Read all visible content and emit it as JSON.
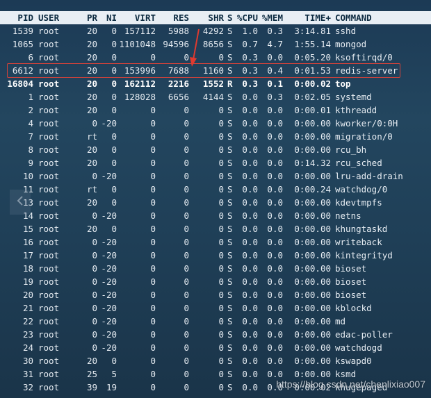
{
  "header": {
    "pid": "PID",
    "user": "USER",
    "pr": "PR",
    "ni": "NI",
    "virt": "VIRT",
    "res": "RES",
    "shr": "SHR",
    "s": "S",
    "cpu": "%CPU",
    "mem": "%MEM",
    "time": "TIME+",
    "cmd": "COMMAND"
  },
  "rows": [
    {
      "pid": "1539",
      "user": "root",
      "pr": "20",
      "ni": "0",
      "virt": "157112",
      "res": "5988",
      "shr": "4292",
      "s": "S",
      "cpu": "1.0",
      "mem": "0.3",
      "time": "3:14.81",
      "cmd": "sshd"
    },
    {
      "pid": "1065",
      "user": "root",
      "pr": "20",
      "ni": "0",
      "virt": "1101048",
      "res": "94596",
      "shr": "8656",
      "s": "S",
      "cpu": "0.7",
      "mem": "4.7",
      "time": "1:55.14",
      "cmd": "mongod"
    },
    {
      "pid": "6",
      "user": "root",
      "pr": "20",
      "ni": "0",
      "virt": "0",
      "res": "0",
      "shr": "0",
      "s": "S",
      "cpu": "0.3",
      "mem": "0.0",
      "time": "0:05.20",
      "cmd": "ksoftirqd/0"
    },
    {
      "pid": "6612",
      "user": "root",
      "pr": "20",
      "ni": "0",
      "virt": "153996",
      "res": "7688",
      "shr": "1160",
      "s": "S",
      "cpu": "0.3",
      "mem": "0.4",
      "time": "0:01.53",
      "cmd": "redis-server"
    },
    {
      "pid": "16804",
      "user": "root",
      "pr": "20",
      "ni": "0",
      "virt": "162112",
      "res": "2216",
      "shr": "1552",
      "s": "R",
      "cpu": "0.3",
      "mem": "0.1",
      "time": "0:00.02",
      "cmd": "top"
    },
    {
      "pid": "1",
      "user": "root",
      "pr": "20",
      "ni": "0",
      "virt": "128028",
      "res": "6656",
      "shr": "4144",
      "s": "S",
      "cpu": "0.0",
      "mem": "0.3",
      "time": "0:02.05",
      "cmd": "systemd"
    },
    {
      "pid": "2",
      "user": "root",
      "pr": "20",
      "ni": "0",
      "virt": "0",
      "res": "0",
      "shr": "0",
      "s": "S",
      "cpu": "0.0",
      "mem": "0.0",
      "time": "0:00.01",
      "cmd": "kthreadd"
    },
    {
      "pid": "4",
      "user": "root",
      "pr": "0",
      "ni": "-20",
      "virt": "0",
      "res": "0",
      "shr": "0",
      "s": "S",
      "cpu": "0.0",
      "mem": "0.0",
      "time": "0:00.00",
      "cmd": "kworker/0:0H"
    },
    {
      "pid": "7",
      "user": "root",
      "pr": "rt",
      "ni": "0",
      "virt": "0",
      "res": "0",
      "shr": "0",
      "s": "S",
      "cpu": "0.0",
      "mem": "0.0",
      "time": "0:00.00",
      "cmd": "migration/0"
    },
    {
      "pid": "8",
      "user": "root",
      "pr": "20",
      "ni": "0",
      "virt": "0",
      "res": "0",
      "shr": "0",
      "s": "S",
      "cpu": "0.0",
      "mem": "0.0",
      "time": "0:00.00",
      "cmd": "rcu_bh"
    },
    {
      "pid": "9",
      "user": "root",
      "pr": "20",
      "ni": "0",
      "virt": "0",
      "res": "0",
      "shr": "0",
      "s": "S",
      "cpu": "0.0",
      "mem": "0.0",
      "time": "0:14.32",
      "cmd": "rcu_sched"
    },
    {
      "pid": "10",
      "user": "root",
      "pr": "0",
      "ni": "-20",
      "virt": "0",
      "res": "0",
      "shr": "0",
      "s": "S",
      "cpu": "0.0",
      "mem": "0.0",
      "time": "0:00.00",
      "cmd": "lru-add-drain"
    },
    {
      "pid": "11",
      "user": "root",
      "pr": "rt",
      "ni": "0",
      "virt": "0",
      "res": "0",
      "shr": "0",
      "s": "S",
      "cpu": "0.0",
      "mem": "0.0",
      "time": "0:00.24",
      "cmd": "watchdog/0"
    },
    {
      "pid": "13",
      "user": "root",
      "pr": "20",
      "ni": "0",
      "virt": "0",
      "res": "0",
      "shr": "0",
      "s": "S",
      "cpu": "0.0",
      "mem": "0.0",
      "time": "0:00.00",
      "cmd": "kdevtmpfs"
    },
    {
      "pid": "14",
      "user": "root",
      "pr": "0",
      "ni": "-20",
      "virt": "0",
      "res": "0",
      "shr": "0",
      "s": "S",
      "cpu": "0.0",
      "mem": "0.0",
      "time": "0:00.00",
      "cmd": "netns"
    },
    {
      "pid": "15",
      "user": "root",
      "pr": "20",
      "ni": "0",
      "virt": "0",
      "res": "0",
      "shr": "0",
      "s": "S",
      "cpu": "0.0",
      "mem": "0.0",
      "time": "0:00.00",
      "cmd": "khungtaskd"
    },
    {
      "pid": "16",
      "user": "root",
      "pr": "0",
      "ni": "-20",
      "virt": "0",
      "res": "0",
      "shr": "0",
      "s": "S",
      "cpu": "0.0",
      "mem": "0.0",
      "time": "0:00.00",
      "cmd": "writeback"
    },
    {
      "pid": "17",
      "user": "root",
      "pr": "0",
      "ni": "-20",
      "virt": "0",
      "res": "0",
      "shr": "0",
      "s": "S",
      "cpu": "0.0",
      "mem": "0.0",
      "time": "0:00.00",
      "cmd": "kintegrityd"
    },
    {
      "pid": "18",
      "user": "root",
      "pr": "0",
      "ni": "-20",
      "virt": "0",
      "res": "0",
      "shr": "0",
      "s": "S",
      "cpu": "0.0",
      "mem": "0.0",
      "time": "0:00.00",
      "cmd": "bioset"
    },
    {
      "pid": "19",
      "user": "root",
      "pr": "0",
      "ni": "-20",
      "virt": "0",
      "res": "0",
      "shr": "0",
      "s": "S",
      "cpu": "0.0",
      "mem": "0.0",
      "time": "0:00.00",
      "cmd": "bioset"
    },
    {
      "pid": "20",
      "user": "root",
      "pr": "0",
      "ni": "-20",
      "virt": "0",
      "res": "0",
      "shr": "0",
      "s": "S",
      "cpu": "0.0",
      "mem": "0.0",
      "time": "0:00.00",
      "cmd": "bioset"
    },
    {
      "pid": "21",
      "user": "root",
      "pr": "0",
      "ni": "-20",
      "virt": "0",
      "res": "0",
      "shr": "0",
      "s": "S",
      "cpu": "0.0",
      "mem": "0.0",
      "time": "0:00.00",
      "cmd": "kblockd"
    },
    {
      "pid": "22",
      "user": "root",
      "pr": "0",
      "ni": "-20",
      "virt": "0",
      "res": "0",
      "shr": "0",
      "s": "S",
      "cpu": "0.0",
      "mem": "0.0",
      "time": "0:00.00",
      "cmd": "md"
    },
    {
      "pid": "23",
      "user": "root",
      "pr": "0",
      "ni": "-20",
      "virt": "0",
      "res": "0",
      "shr": "0",
      "s": "S",
      "cpu": "0.0",
      "mem": "0.0",
      "time": "0:00.00",
      "cmd": "edac-poller"
    },
    {
      "pid": "24",
      "user": "root",
      "pr": "0",
      "ni": "-20",
      "virt": "0",
      "res": "0",
      "shr": "0",
      "s": "S",
      "cpu": "0.0",
      "mem": "0.0",
      "time": "0:00.00",
      "cmd": "watchdogd"
    },
    {
      "pid": "30",
      "user": "root",
      "pr": "20",
      "ni": "0",
      "virt": "0",
      "res": "0",
      "shr": "0",
      "s": "S",
      "cpu": "0.0",
      "mem": "0.0",
      "time": "0:00.00",
      "cmd": "kswapd0"
    },
    {
      "pid": "31",
      "user": "root",
      "pr": "25",
      "ni": "5",
      "virt": "0",
      "res": "0",
      "shr": "0",
      "s": "S",
      "cpu": "0.0",
      "mem": "0.0",
      "time": "0:00.00",
      "cmd": "ksmd"
    },
    {
      "pid": "32",
      "user": "root",
      "pr": "39",
      "ni": "19",
      "virt": "0",
      "res": "0",
      "shr": "0",
      "s": "S",
      "cpu": "0.0",
      "mem": "0.0",
      "time": "0:00.02",
      "cmd": "khugepaged"
    }
  ],
  "watermark": "https://blog.csdn.net/chenlixiao007",
  "colors": {
    "header_bg": "#e8eef4",
    "highlight": "#d0423a",
    "text": "#e6ecf2"
  },
  "icons": {
    "arrow": "red-arrow-icon",
    "nav": "chevron-left-icon"
  }
}
